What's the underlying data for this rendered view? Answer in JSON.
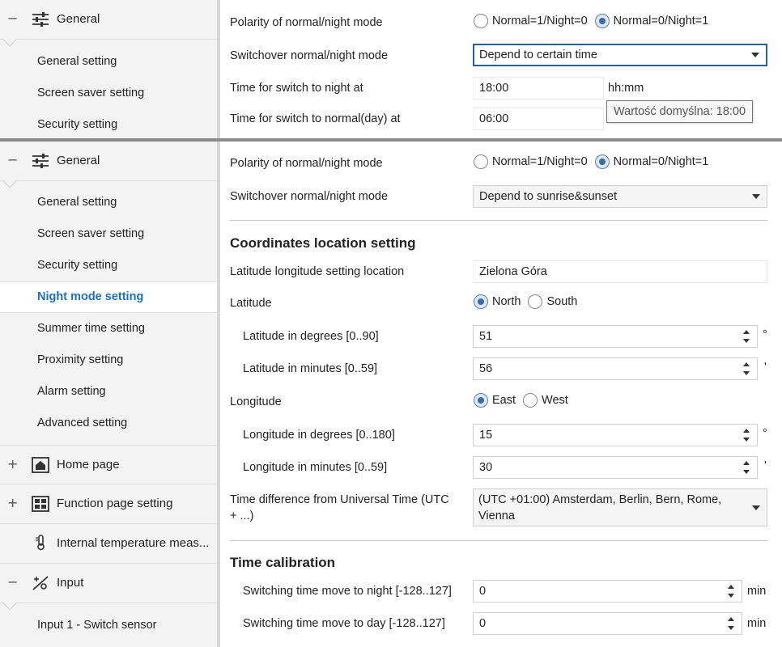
{
  "top_pane": {
    "sidebar": {
      "group_label": "General",
      "group_toggle": "−",
      "items": [
        "General setting",
        "Screen saver setting",
        "Security setting"
      ]
    },
    "polarity": {
      "label": "Polarity of normal/night mode",
      "option1": "Normal=1/Night=0",
      "option2": "Normal=0/Night=1",
      "selected": "option2"
    },
    "switchover": {
      "label": "Switchover normal/night mode",
      "value": "Depend to certain time"
    },
    "night_time": {
      "label": "Time for switch to night at",
      "value": "18:00",
      "unit": "hh:mm"
    },
    "day_time": {
      "label": "Time for switch to normal(day) at",
      "value": "06:00"
    },
    "tooltip": "Wartość domyślna: 18:00"
  },
  "bottom_pane": {
    "sidebar": {
      "general": {
        "label": "General",
        "toggle": "−"
      },
      "items": [
        "General setting",
        "Screen saver setting",
        "Security setting",
        "Night mode setting",
        "Summer time setting",
        "Proximity setting",
        "Alarm setting",
        "Advanced setting"
      ],
      "active_index": 3,
      "home": {
        "label": "Home page",
        "toggle": "+"
      },
      "function": {
        "label": "Function page setting",
        "toggle": "+"
      },
      "internal": {
        "label": "Internal temperature meas..."
      },
      "input": {
        "label": "Input",
        "toggle": "−"
      },
      "input_items": [
        "Input 1 - Switch sensor"
      ]
    },
    "polarity": {
      "label": "Polarity of normal/night mode",
      "option1": "Normal=1/Night=0",
      "option2": "Normal=0/Night=1"
    },
    "switchover": {
      "label": "Switchover normal/night mode",
      "value": "Depend to sunrise&sunset"
    },
    "coordinates": {
      "title": "Coordinates location setting",
      "location": {
        "label": "Latitude longitude setting location",
        "value": "Zielona Góra"
      },
      "latitude": {
        "label": "Latitude",
        "option1": "North",
        "option2": "South"
      },
      "lat_deg": {
        "label": "Latitude in degrees [0..90]",
        "value": "51",
        "unit": "°"
      },
      "lat_min": {
        "label": "Latitude in minutes [0..59]",
        "value": "56",
        "unit": "'"
      },
      "longitude": {
        "label": "Longitude",
        "option1": "East",
        "option2": "West"
      },
      "lon_deg": {
        "label": "Longitude in degrees [0..180]",
        "value": "15",
        "unit": "°"
      },
      "lon_min": {
        "label": "Longitude in minutes [0..59]",
        "value": "30",
        "unit": "'"
      },
      "utc": {
        "label_line1": "Time difference from Universal Time (UTC",
        "label_line2": "+ ...)",
        "value": "(UTC +01:00) Amsterdam, Berlin, Bern, Rome, Vienna"
      }
    },
    "calibration": {
      "title": "Time calibration",
      "to_night": {
        "label": "Switching time move to night [-128..127]",
        "value": "0",
        "unit": "min"
      },
      "to_day": {
        "label": "Switching time move to day [-128..127]",
        "value": "0",
        "unit": "min"
      }
    }
  },
  "icons": {
    "general": "sliders-icon",
    "home": "home-icon",
    "function": "grid-icon",
    "internal": "thermometer-icon",
    "input": "input-switch-icon"
  },
  "colors": {
    "active_item": "#1f6fb2",
    "sidebar_bg": "#f3f3f3",
    "splitter": "#8a8a8a"
  }
}
